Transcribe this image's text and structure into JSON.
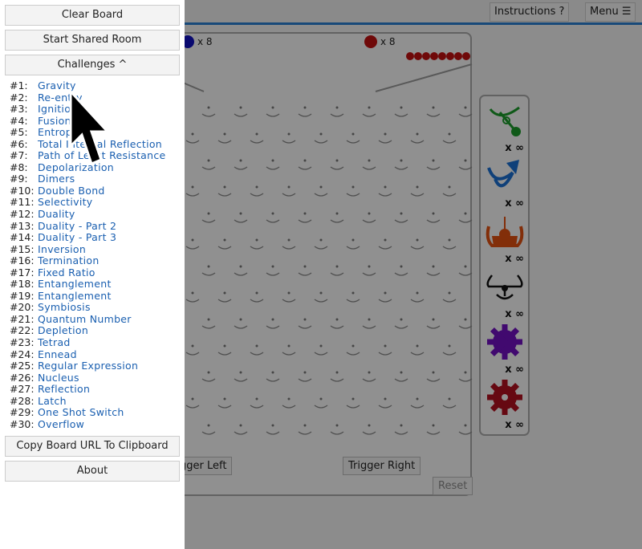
{
  "topbar": {
    "instructions": "Instructions ?",
    "menu": "Menu ☰"
  },
  "board": {
    "blue_count": "x 8",
    "red_count": "x 8",
    "red_queue": 8,
    "trigger_left": "Trigger Left",
    "trigger_right": "Trigger Right",
    "reset": "Reset",
    "colors": {
      "blue": "#1010c0",
      "red": "#c01010",
      "accent": "#2a7fd0"
    }
  },
  "parts": [
    {
      "name": "bit",
      "color": "#1a9a2a",
      "count": "x ∞"
    },
    {
      "name": "ramp",
      "color": "#1a6fd0",
      "count": "x ∞"
    },
    {
      "name": "crossover",
      "color": "#e05010",
      "count": "x ∞"
    },
    {
      "name": "interceptor",
      "color": "#111111",
      "count": "x ∞"
    },
    {
      "name": "gear-bit",
      "color": "#7010c0",
      "count": "x ∞"
    },
    {
      "name": "gear",
      "color": "#b01020",
      "count": "x ∞"
    }
  ],
  "sidebar": {
    "clear": "Clear Board",
    "shared": "Start Shared Room",
    "challenges": "Challenges ^",
    "copy": "Copy Board URL To Clipboard",
    "about": "About",
    "items": [
      {
        "n": "#1:",
        "t": "Gravity"
      },
      {
        "n": "#2:",
        "t": "Re-entry"
      },
      {
        "n": "#3:",
        "t": "Ignition"
      },
      {
        "n": "#4:",
        "t": "Fusion"
      },
      {
        "n": "#5:",
        "t": "Entropy"
      },
      {
        "n": "#6:",
        "t": "Total Internal Reflection"
      },
      {
        "n": "#7:",
        "t": "Path of Least Resistance"
      },
      {
        "n": "#8:",
        "t": "Depolarization"
      },
      {
        "n": "#9:",
        "t": "Dimers"
      },
      {
        "n": "#10:",
        "t": "Double Bond"
      },
      {
        "n": "#11:",
        "t": "Selectivity"
      },
      {
        "n": "#12:",
        "t": "Duality"
      },
      {
        "n": "#13:",
        "t": "Duality - Part 2"
      },
      {
        "n": "#14:",
        "t": "Duality - Part 3"
      },
      {
        "n": "#15:",
        "t": "Inversion"
      },
      {
        "n": "#16:",
        "t": "Termination"
      },
      {
        "n": "#17:",
        "t": "Fixed Ratio"
      },
      {
        "n": "#18:",
        "t": "Entanglement"
      },
      {
        "n": "#19:",
        "t": "Entanglement"
      },
      {
        "n": "#20:",
        "t": "Symbiosis"
      },
      {
        "n": "#21:",
        "t": "Quantum Number"
      },
      {
        "n": "#22:",
        "t": "Depletion"
      },
      {
        "n": "#23:",
        "t": "Tetrad"
      },
      {
        "n": "#24:",
        "t": "Ennead"
      },
      {
        "n": "#25:",
        "t": "Regular Expression"
      },
      {
        "n": "#26:",
        "t": "Nucleus"
      },
      {
        "n": "#27:",
        "t": "Reflection"
      },
      {
        "n": "#28:",
        "t": "Latch"
      },
      {
        "n": "#29:",
        "t": "One Shot Switch"
      },
      {
        "n": "#30:",
        "t": "Overflow"
      }
    ]
  }
}
